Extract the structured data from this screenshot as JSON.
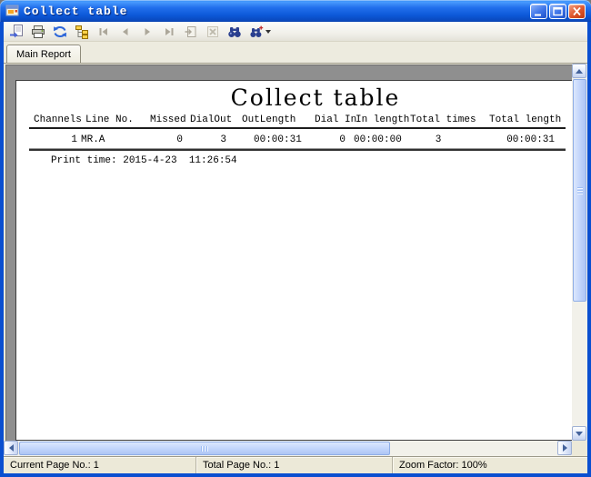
{
  "window": {
    "title": "Collect table"
  },
  "toolbar": {
    "buttons": [
      {
        "name": "export",
        "enabled": true
      },
      {
        "name": "print",
        "enabled": true
      },
      {
        "name": "refresh",
        "enabled": true
      },
      {
        "name": "toggle-group-tree",
        "enabled": true
      },
      {
        "name": "first-page",
        "enabled": false
      },
      {
        "name": "previous-page",
        "enabled": false
      },
      {
        "name": "next-page",
        "enabled": false
      },
      {
        "name": "last-page",
        "enabled": false
      },
      {
        "name": "goto-page",
        "enabled": false
      },
      {
        "name": "cancel",
        "enabled": false
      },
      {
        "name": "search-text",
        "enabled": true
      },
      {
        "name": "zoom",
        "enabled": true
      }
    ]
  },
  "tabs": [
    {
      "label": "Main Report",
      "active": true
    }
  ],
  "report": {
    "title": "Collect table",
    "columns": [
      "Channels",
      "Line No.",
      "Missed",
      "DialOut",
      "OutLength",
      "Dial In",
      "In length",
      "Total times",
      "Total length"
    ],
    "rows": [
      [
        "1",
        "MR.A",
        "0",
        "3",
        "00:00:31",
        "0",
        "00:00:00",
        "3",
        "00:00:31"
      ]
    ],
    "print_time": "Print time: 2015-4-23  11:26:54"
  },
  "status_bar": {
    "current_page": "Current Page No.: 1",
    "total_page": "Total Page No.: 1",
    "zoom_factor": "Zoom Factor: 100%"
  },
  "colors": {
    "titlebar_blue": "#0C58D8",
    "window_border": "#0A4FD0",
    "chrome_tan": "#ECE9D8",
    "canvas_gray": "#8F8F8F",
    "scroll_thumb_blue": "#C3D6FB",
    "close_button_red": "#DD552B"
  }
}
